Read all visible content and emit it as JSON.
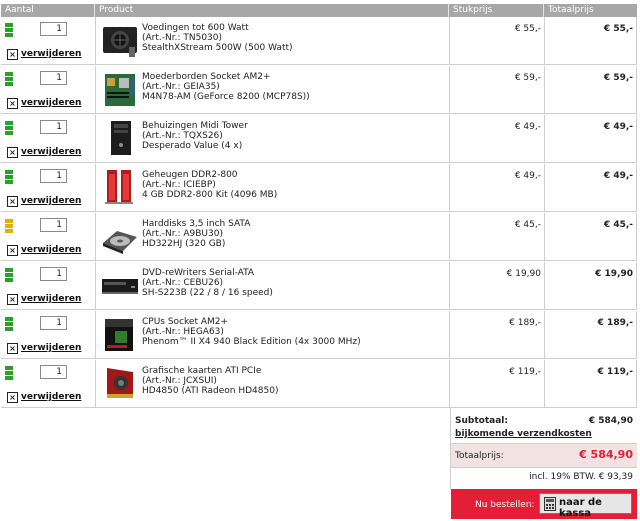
{
  "columns": {
    "aantal": "Aantal",
    "product": "Product",
    "stukprijs": "Stukprijs",
    "totaalprijs": "Totaalprijs"
  },
  "remove_label": "verwijderen",
  "colors": {
    "stock_green": "#2aa02a",
    "stock_yellow": "#e0b000",
    "accent_red": "#e41e36"
  },
  "items": [
    {
      "qty": "1",
      "category": "Voedingen tot 600 Watt",
      "artnr": "(Art.-Nr.: TN5030)",
      "name": "StealthXStream 500W (500 Watt)",
      "unit_price": "€ 55,-",
      "total_price": "€ 55,-",
      "stock": "green",
      "icon": "power-supply-icon"
    },
    {
      "qty": "1",
      "category": "Moederborden Socket AM2+",
      "artnr": "(Art.-Nr.: GEIA35)",
      "name": "M4N78-AM (GeForce 8200 (MCP78S))",
      "unit_price": "€ 59,-",
      "total_price": "€ 59,-",
      "stock": "green",
      "icon": "motherboard-icon"
    },
    {
      "qty": "1",
      "category": "Behuizingen Midi Tower",
      "artnr": "(Art.-Nr.: TQXS26)",
      "name": "Desperado Value (4 x)",
      "unit_price": "€ 49,-",
      "total_price": "€ 49,-",
      "stock": "green",
      "icon": "pc-case-icon"
    },
    {
      "qty": "1",
      "category": "Geheugen DDR2-800",
      "artnr": "(Art.-Nr.: ICIEBP)",
      "name": "4 GB DDR2-800 Kit (4096 MB)",
      "unit_price": "€ 49,-",
      "total_price": "€ 49,-",
      "stock": "green",
      "icon": "memory-icon"
    },
    {
      "qty": "1",
      "category": "Harddisks 3,5 inch SATA",
      "artnr": "(Art.-Nr.: A9BU30)",
      "name": "HD322HJ (320 GB)",
      "unit_price": "€ 45,-",
      "total_price": "€ 45,-",
      "stock": "yellow",
      "icon": "harddisk-icon"
    },
    {
      "qty": "1",
      "category": "DVD-reWriters Serial-ATA",
      "artnr": "(Art.-Nr.: CEBU26)",
      "name": "SH-S223B (22 / 8 / 16 speed)",
      "unit_price": "€ 19,90",
      "total_price": "€ 19,90",
      "stock": "green",
      "icon": "dvd-drive-icon"
    },
    {
      "qty": "1",
      "category": "CPUs Socket AM2+",
      "artnr": "(Art.-Nr.: HEGA63)",
      "name": "Phenom™ II X4 940 Black Edition (4x 3000 MHz)",
      "unit_price": "€ 189,-",
      "total_price": "€ 189,-",
      "stock": "green",
      "icon": "cpu-box-icon"
    },
    {
      "qty": "1",
      "category": "Grafische kaarten ATI PCIe",
      "artnr": "(Art.-Nr.: JCXSUI)",
      "name": "HD4850 (ATI Radeon HD4850)",
      "unit_price": "€ 119,-",
      "total_price": "€ 119,-",
      "stock": "green",
      "icon": "graphics-card-icon"
    }
  ],
  "summary": {
    "subtotal_label": "Subtotaal:",
    "subtotal_value": "€ 584,90",
    "shipping_link": "bijkomende verzendkosten",
    "total_label": "Totaalprijs:",
    "total_value": "€ 584,90",
    "vat_note": "incl. 19% BTW. € 93,39",
    "order_label": "Nu bestellen:",
    "checkout_label": "naar de kassa"
  }
}
